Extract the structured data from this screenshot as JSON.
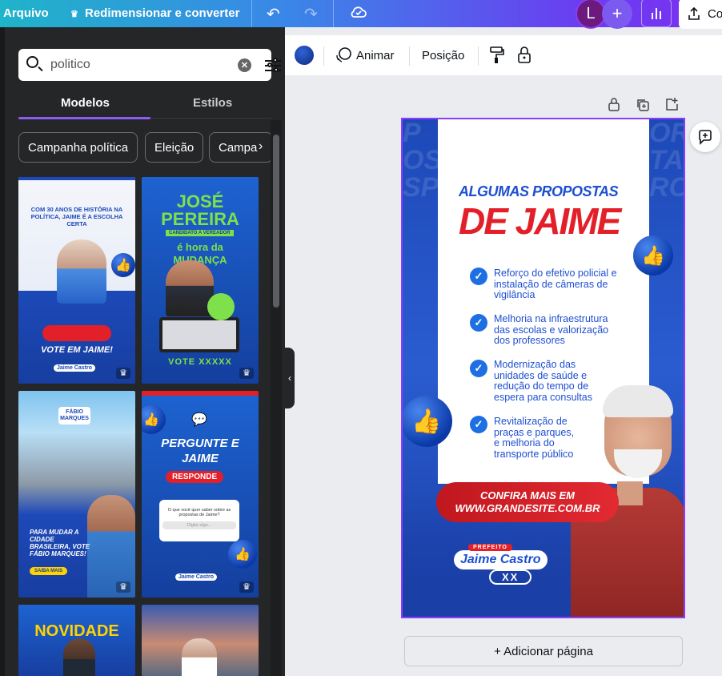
{
  "topbar": {
    "file_label": "Arquivo",
    "resize_label": "Redimensionar e converter",
    "avatar_initial": "L",
    "share_label": "Co"
  },
  "search": {
    "query": "politico"
  },
  "tabs": [
    {
      "label": "Modelos",
      "active": true
    },
    {
      "label": "Estilos",
      "active": false
    }
  ],
  "chips": [
    "Campanha política",
    "Eleição",
    "Campa"
  ],
  "templates": [
    {
      "headline": "COM 30 ANOS DE HISTÓRIA NA POLÍTICA, JAIME É A ESCOLHA CERTA",
      "cta": "VOTE EM JAIME!",
      "name": "Jaime Castro"
    },
    {
      "headline": "JOSÉ PEREIRA",
      "subtitle": "CANDIDATO A VEREADOR",
      "text": "é hora da MUDANÇA",
      "cta": "VOTE XXXXX"
    },
    {
      "headline": "FÁBIO MARQUES",
      "text": "PARA MUDAR A CIDADE BRASILEIRA, VOTE FÁBIO MARQUES!",
      "cta": "SAIBA MAIS"
    },
    {
      "headline": "PERGUNTE E JAIME",
      "subtitle": "RESPONDE",
      "text": "O que você quer saber sobre as propostas de Jaime?",
      "input": "Digite algo...",
      "name": "Jaime Castro"
    },
    {
      "headline": "NOVIDADE"
    },
    {
      "headline": ""
    }
  ],
  "toolbar": {
    "animate_label": "Animar",
    "position_label": "Posição",
    "color": "#1d49b8"
  },
  "poster": {
    "title_small": "ALGUMAS PROPOSTAS",
    "title_big": "DE JAIME",
    "proposals": [
      "Reforço do efetivo policial e instalação de câmeras de vigilância",
      "Melhoria na infraestrutura das escolas e valorização dos professores",
      "Modernização das unidades de saúde e redução do tempo de espera para consultas",
      "Revitalização de praças e parques, e melhoria do transporte público"
    ],
    "cta_line1": "CONFIRA MAIS EM",
    "cta_line2": "WWW.GRANDESITE.COM.BR",
    "badge": "PREFEITO",
    "name": "Jaime Castro",
    "number": "XX"
  },
  "canvas": {
    "add_page_label": "+ Adicionar página"
  }
}
